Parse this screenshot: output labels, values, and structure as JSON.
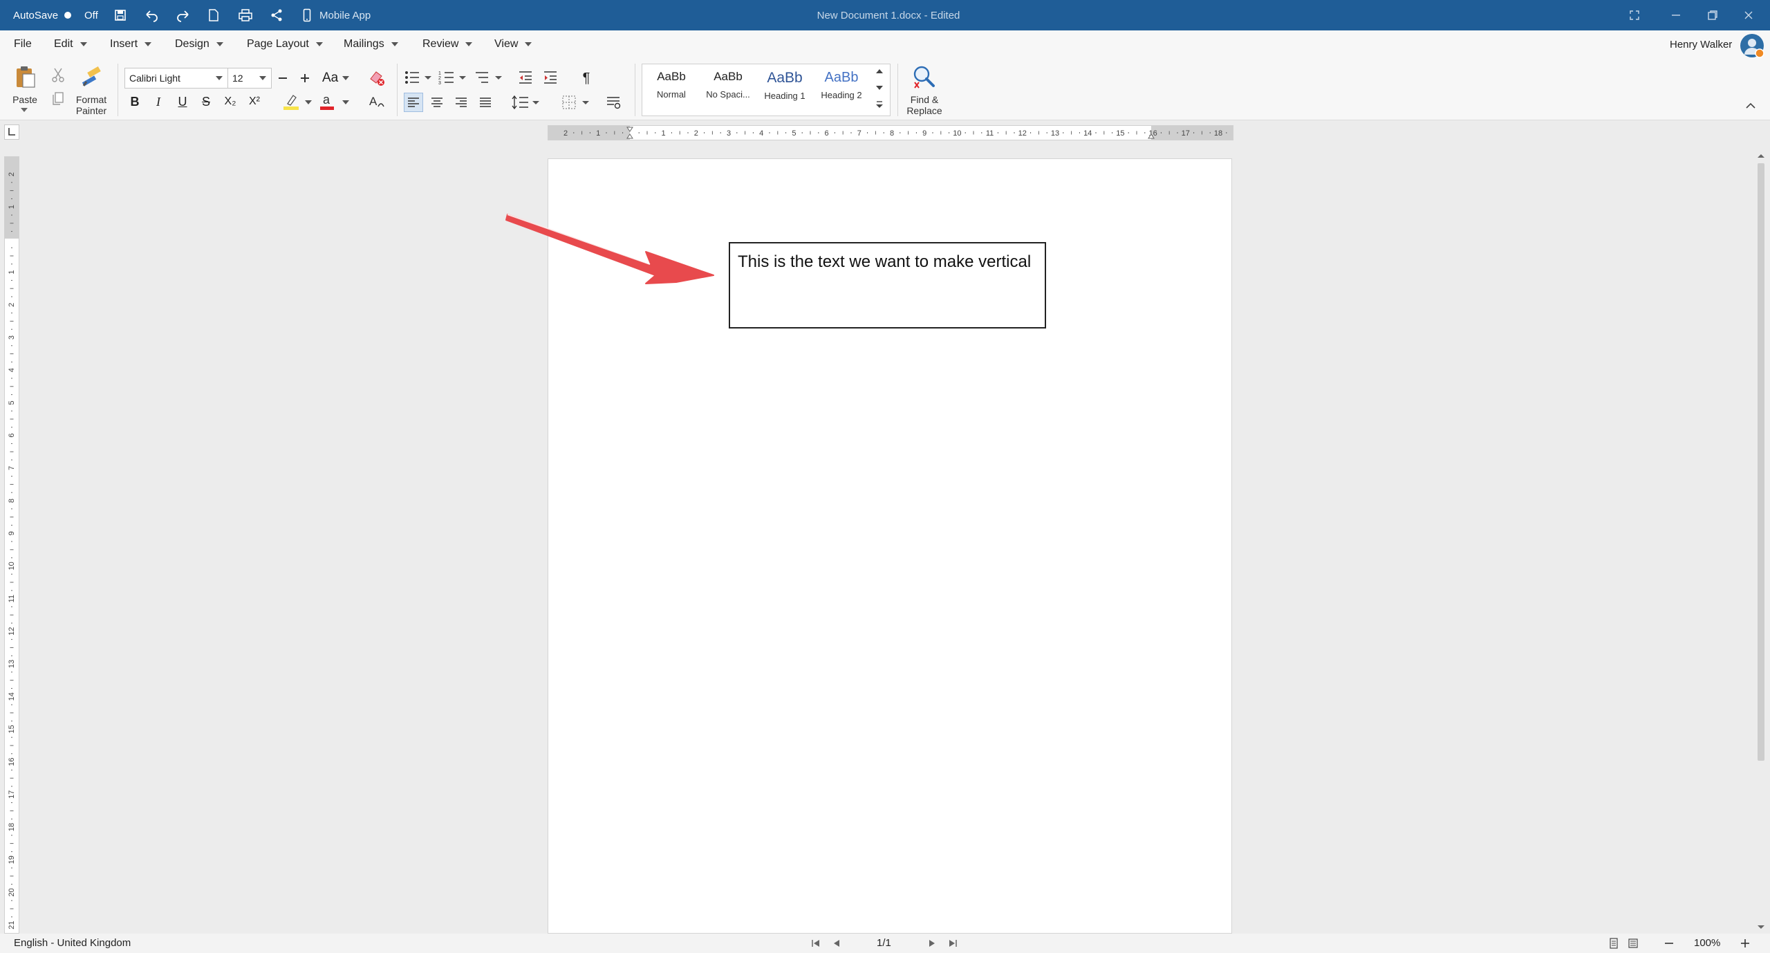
{
  "titlebar": {
    "autosave_label": "AutoSave",
    "autosave_state": "Off",
    "mobile_app_label": "Mobile App",
    "document_title": "New Document 1.docx - Edited",
    "bg_color": "#1f5d97"
  },
  "menu": {
    "file": "File",
    "edit": "Edit",
    "insert": "Insert",
    "design": "Design",
    "page_layout": "Page Layout",
    "mailings": "Mailings",
    "review": "Review",
    "view": "View",
    "user_name": "Henry Walker"
  },
  "ribbon": {
    "paste_label": "Paste",
    "format_painter_line1": "Format",
    "format_painter_line2": "Painter",
    "font_name": "Calibri Light",
    "font_size": "12",
    "bold": "B",
    "italic": "I",
    "underline": "U",
    "strikethrough": "S",
    "subscript": "X₂",
    "superscript": "X²",
    "change_case": "Aa",
    "pilcrow": "¶",
    "highlight_color": "#f7e34a",
    "font_color": "#e0242a",
    "find_replace_line1": "Find &",
    "find_replace_line2": "Replace",
    "styles": [
      {
        "preview": "AaBb",
        "name": "Normal",
        "color": "#222222"
      },
      {
        "preview": "AaBb",
        "name": "No Spaci...",
        "color": "#222222"
      },
      {
        "preview": "AaBb",
        "name": "Heading 1",
        "color": "#2f5496"
      },
      {
        "preview": "AaBb",
        "name": "Heading 2",
        "color": "#4472c4"
      }
    ]
  },
  "ruler": {
    "h_ticks": [
      "2",
      "1",
      "",
      "1",
      "2",
      "3",
      "4",
      "5",
      "6",
      "7",
      "8",
      "9",
      "10",
      "11",
      "12",
      "13",
      "14",
      "15",
      "16",
      "17",
      "18"
    ],
    "v_ticks": [
      "2",
      "1",
      "",
      "1",
      "2",
      "3",
      "4",
      "5",
      "6",
      "7",
      "8",
      "9",
      "10",
      "11",
      "12",
      "13",
      "14",
      "15",
      "16",
      "17",
      "18",
      "19",
      "20",
      "21"
    ]
  },
  "document": {
    "textbox_text": "This is the text we want to make vertical",
    "arrow_color": "#e84a4d"
  },
  "status": {
    "language": "English - United Kingdom",
    "page_indicator": "1/1",
    "zoom": "100%"
  }
}
